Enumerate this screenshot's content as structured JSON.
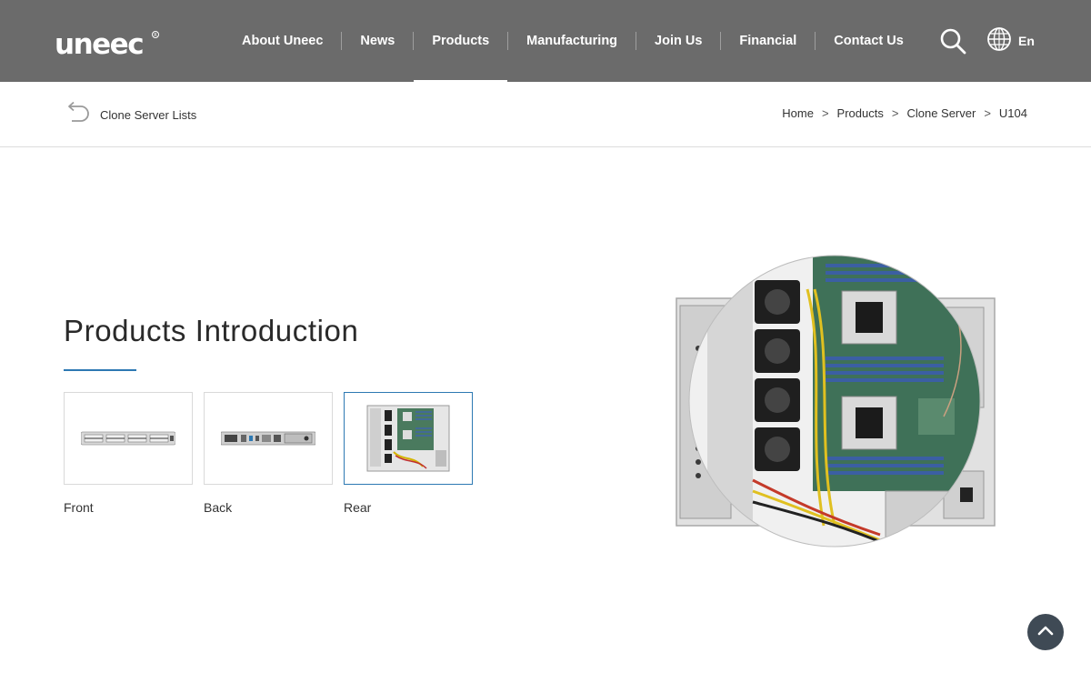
{
  "brand": {
    "logo_text": "uneec"
  },
  "nav": {
    "items": [
      {
        "label": "About Uneec"
      },
      {
        "label": "News"
      },
      {
        "label": "Products"
      },
      {
        "label": "Manufacturing"
      },
      {
        "label": "Join Us"
      },
      {
        "label": "Financial"
      },
      {
        "label": "Contact Us"
      }
    ],
    "active": "Products",
    "language": "En"
  },
  "subbar": {
    "back_label": "Clone Server Lists",
    "breadcrumb": [
      "Home",
      "Products",
      "Clone Server",
      "U104"
    ],
    "separator": ">"
  },
  "intro": {
    "title": "Products Introduction",
    "thumbnails": [
      {
        "label": "Front"
      },
      {
        "label": "Back"
      },
      {
        "label": "Rear",
        "selected": true
      }
    ]
  },
  "colors": {
    "header_bg": "#6b6b6b",
    "accent": "#2d79b3",
    "to_top_bg": "#3f4a55"
  },
  "icons": {
    "search": "search-icon",
    "language": "globe-icon",
    "back": "back-arrow-icon",
    "scroll_top": "chevron-up-icon"
  }
}
